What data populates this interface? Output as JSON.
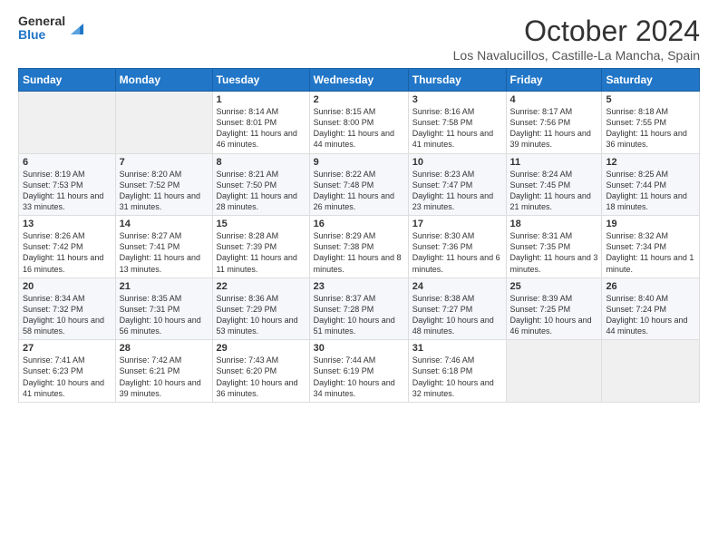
{
  "header": {
    "logo": {
      "general": "General",
      "blue": "Blue"
    },
    "title": "October 2024",
    "location": "Los Navalucillos, Castille-La Mancha, Spain"
  },
  "days_of_week": [
    "Sunday",
    "Monday",
    "Tuesday",
    "Wednesday",
    "Thursday",
    "Friday",
    "Saturday"
  ],
  "weeks": [
    [
      {
        "day": "",
        "info": ""
      },
      {
        "day": "",
        "info": ""
      },
      {
        "day": "1",
        "info": "Sunrise: 8:14 AM\nSunset: 8:01 PM\nDaylight: 11 hours and 46 minutes."
      },
      {
        "day": "2",
        "info": "Sunrise: 8:15 AM\nSunset: 8:00 PM\nDaylight: 11 hours and 44 minutes."
      },
      {
        "day": "3",
        "info": "Sunrise: 8:16 AM\nSunset: 7:58 PM\nDaylight: 11 hours and 41 minutes."
      },
      {
        "day": "4",
        "info": "Sunrise: 8:17 AM\nSunset: 7:56 PM\nDaylight: 11 hours and 39 minutes."
      },
      {
        "day": "5",
        "info": "Sunrise: 8:18 AM\nSunset: 7:55 PM\nDaylight: 11 hours and 36 minutes."
      }
    ],
    [
      {
        "day": "6",
        "info": "Sunrise: 8:19 AM\nSunset: 7:53 PM\nDaylight: 11 hours and 33 minutes."
      },
      {
        "day": "7",
        "info": "Sunrise: 8:20 AM\nSunset: 7:52 PM\nDaylight: 11 hours and 31 minutes."
      },
      {
        "day": "8",
        "info": "Sunrise: 8:21 AM\nSunset: 7:50 PM\nDaylight: 11 hours and 28 minutes."
      },
      {
        "day": "9",
        "info": "Sunrise: 8:22 AM\nSunset: 7:48 PM\nDaylight: 11 hours and 26 minutes."
      },
      {
        "day": "10",
        "info": "Sunrise: 8:23 AM\nSunset: 7:47 PM\nDaylight: 11 hours and 23 minutes."
      },
      {
        "day": "11",
        "info": "Sunrise: 8:24 AM\nSunset: 7:45 PM\nDaylight: 11 hours and 21 minutes."
      },
      {
        "day": "12",
        "info": "Sunrise: 8:25 AM\nSunset: 7:44 PM\nDaylight: 11 hours and 18 minutes."
      }
    ],
    [
      {
        "day": "13",
        "info": "Sunrise: 8:26 AM\nSunset: 7:42 PM\nDaylight: 11 hours and 16 minutes."
      },
      {
        "day": "14",
        "info": "Sunrise: 8:27 AM\nSunset: 7:41 PM\nDaylight: 11 hours and 13 minutes."
      },
      {
        "day": "15",
        "info": "Sunrise: 8:28 AM\nSunset: 7:39 PM\nDaylight: 11 hours and 11 minutes."
      },
      {
        "day": "16",
        "info": "Sunrise: 8:29 AM\nSunset: 7:38 PM\nDaylight: 11 hours and 8 minutes."
      },
      {
        "day": "17",
        "info": "Sunrise: 8:30 AM\nSunset: 7:36 PM\nDaylight: 11 hours and 6 minutes."
      },
      {
        "day": "18",
        "info": "Sunrise: 8:31 AM\nSunset: 7:35 PM\nDaylight: 11 hours and 3 minutes."
      },
      {
        "day": "19",
        "info": "Sunrise: 8:32 AM\nSunset: 7:34 PM\nDaylight: 11 hours and 1 minute."
      }
    ],
    [
      {
        "day": "20",
        "info": "Sunrise: 8:34 AM\nSunset: 7:32 PM\nDaylight: 10 hours and 58 minutes."
      },
      {
        "day": "21",
        "info": "Sunrise: 8:35 AM\nSunset: 7:31 PM\nDaylight: 10 hours and 56 minutes."
      },
      {
        "day": "22",
        "info": "Sunrise: 8:36 AM\nSunset: 7:29 PM\nDaylight: 10 hours and 53 minutes."
      },
      {
        "day": "23",
        "info": "Sunrise: 8:37 AM\nSunset: 7:28 PM\nDaylight: 10 hours and 51 minutes."
      },
      {
        "day": "24",
        "info": "Sunrise: 8:38 AM\nSunset: 7:27 PM\nDaylight: 10 hours and 48 minutes."
      },
      {
        "day": "25",
        "info": "Sunrise: 8:39 AM\nSunset: 7:25 PM\nDaylight: 10 hours and 46 minutes."
      },
      {
        "day": "26",
        "info": "Sunrise: 8:40 AM\nSunset: 7:24 PM\nDaylight: 10 hours and 44 minutes."
      }
    ],
    [
      {
        "day": "27",
        "info": "Sunrise: 7:41 AM\nSunset: 6:23 PM\nDaylight: 10 hours and 41 minutes."
      },
      {
        "day": "28",
        "info": "Sunrise: 7:42 AM\nSunset: 6:21 PM\nDaylight: 10 hours and 39 minutes."
      },
      {
        "day": "29",
        "info": "Sunrise: 7:43 AM\nSunset: 6:20 PM\nDaylight: 10 hours and 36 minutes."
      },
      {
        "day": "30",
        "info": "Sunrise: 7:44 AM\nSunset: 6:19 PM\nDaylight: 10 hours and 34 minutes."
      },
      {
        "day": "31",
        "info": "Sunrise: 7:46 AM\nSunset: 6:18 PM\nDaylight: 10 hours and 32 minutes."
      },
      {
        "day": "",
        "info": ""
      },
      {
        "day": "",
        "info": ""
      }
    ]
  ]
}
